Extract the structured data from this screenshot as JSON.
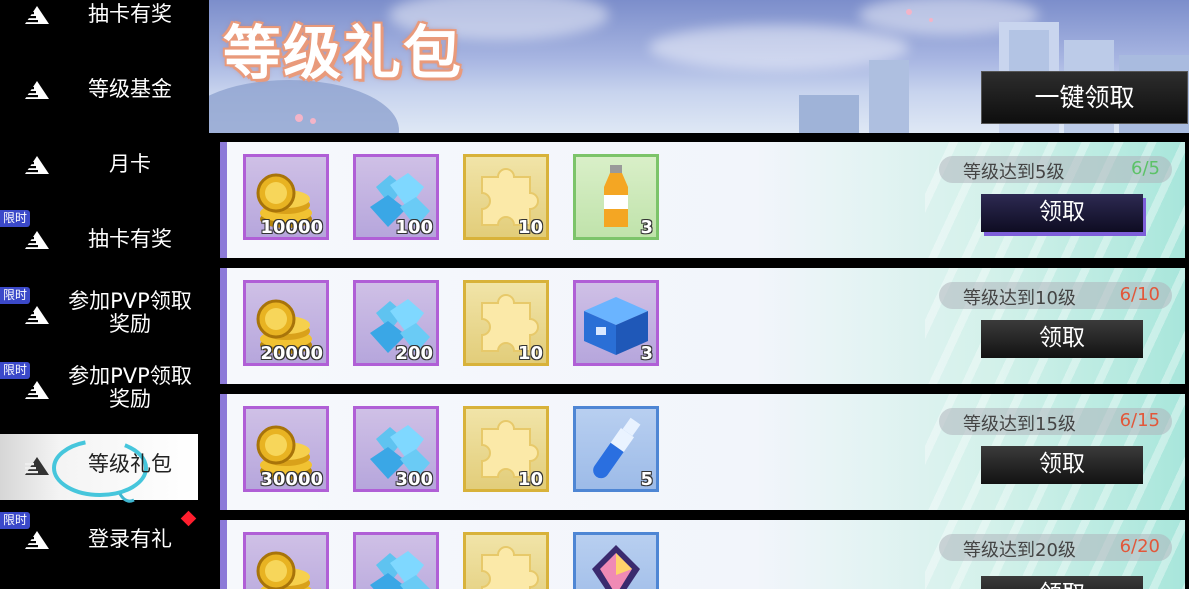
{
  "sidebar": {
    "items": [
      {
        "label": "抽卡有奖",
        "icon": "rank-icon",
        "limited": false,
        "active": false
      },
      {
        "label": "等级基金",
        "icon": "rank-icon",
        "limited": false,
        "active": false
      },
      {
        "label": "月卡",
        "icon": "rank-icon",
        "limited": false,
        "active": false
      },
      {
        "label": "抽卡有奖",
        "icon": "rank-icon",
        "limited": true,
        "active": false
      },
      {
        "label": "参加PVP领取奖励",
        "icon": "rank-icon",
        "limited": true,
        "active": false
      },
      {
        "label": "参加PVP领取奖励",
        "icon": "rank-icon",
        "limited": true,
        "active": false
      },
      {
        "label": "等级礼包",
        "icon": "rank-icon",
        "limited": false,
        "active": true
      },
      {
        "label": "登录有礼",
        "icon": "rank-icon",
        "limited": true,
        "active": false,
        "notification": true
      }
    ],
    "limited_tag": "限时"
  },
  "banner": {
    "title": "等级礼包",
    "claim_all_label": "一键领取"
  },
  "rows": [
    {
      "requirement": "等级达到5级",
      "progress": "6/5",
      "claimable": true,
      "claim_label": "领取",
      "items": [
        {
          "icon": "gold-coins-icon",
          "qty": "10000",
          "rarity": "purple"
        },
        {
          "icon": "blue-diamonds-icon",
          "qty": "100",
          "rarity": "purple"
        },
        {
          "icon": "puzzle-piece-icon",
          "qty": "10",
          "rarity": "gold"
        },
        {
          "icon": "juice-bottle-icon",
          "qty": "3",
          "rarity": "green"
        }
      ]
    },
    {
      "requirement": "等级达到10级",
      "progress": "6/10",
      "claimable": false,
      "claim_label": "领取",
      "items": [
        {
          "icon": "gold-coins-icon",
          "qty": "20000",
          "rarity": "purple"
        },
        {
          "icon": "blue-diamonds-icon",
          "qty": "200",
          "rarity": "purple"
        },
        {
          "icon": "puzzle-piece-icon",
          "qty": "10",
          "rarity": "gold"
        },
        {
          "icon": "blue-chest-icon",
          "qty": "3",
          "rarity": "purple"
        }
      ]
    },
    {
      "requirement": "等级达到15级",
      "progress": "6/15",
      "claimable": false,
      "claim_label": "领取",
      "items": [
        {
          "icon": "gold-coins-icon",
          "qty": "30000",
          "rarity": "purple"
        },
        {
          "icon": "blue-diamonds-icon",
          "qty": "300",
          "rarity": "purple"
        },
        {
          "icon": "puzzle-piece-icon",
          "qty": "10",
          "rarity": "gold"
        },
        {
          "icon": "potion-bottle-icon",
          "qty": "5",
          "rarity": "blue"
        }
      ]
    },
    {
      "requirement": "等级达到20级",
      "progress": "6/20",
      "claimable": false,
      "claim_label": "领取",
      "items": [
        {
          "icon": "gold-coins-icon",
          "qty": "",
          "rarity": "purple"
        },
        {
          "icon": "blue-diamonds-icon",
          "qty": "",
          "rarity": "purple"
        },
        {
          "icon": "puzzle-piece-icon",
          "qty": "",
          "rarity": "gold"
        },
        {
          "icon": "crystal-shard-icon",
          "qty": "",
          "rarity": "blue"
        }
      ]
    }
  ]
}
